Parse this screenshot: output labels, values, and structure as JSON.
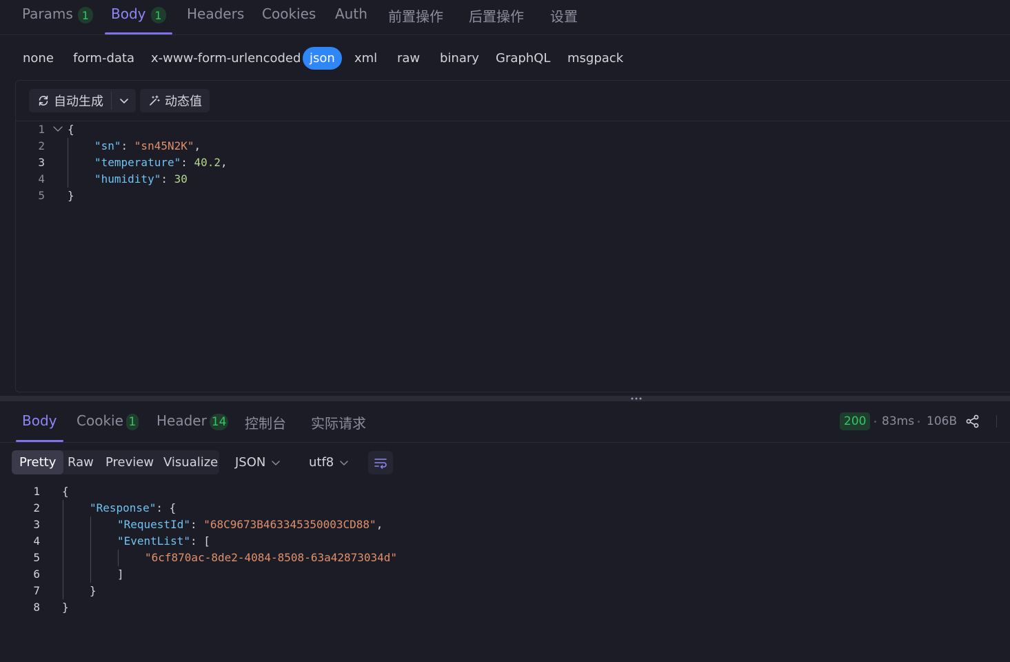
{
  "request_tabs": [
    {
      "label": "Params",
      "badge": "1"
    },
    {
      "label": "Body",
      "badge": "1",
      "active": true
    },
    {
      "label": "Headers"
    },
    {
      "label": "Cookies"
    },
    {
      "label": "Auth"
    },
    {
      "label": "前置操作"
    },
    {
      "label": "后置操作"
    },
    {
      "label": "设置"
    }
  ],
  "body_types": [
    "none",
    "form-data",
    "x-www-form-urlencoded",
    "json",
    "xml",
    "raw",
    "binary",
    "GraphQL",
    "msgpack"
  ],
  "body_type_active": "json",
  "toolbar": {
    "auto_generate": "自动生成",
    "dynamic_value": "动态值"
  },
  "request_body": {
    "line_numbers": [
      "1",
      "2",
      "3",
      "4",
      "5"
    ],
    "open_brace": "{",
    "close_brace": "}",
    "fields": [
      {
        "key": "\"sn\"",
        "sep": ": ",
        "value": "\"sn45N2K\"",
        "value_type": "string",
        "trail": ","
      },
      {
        "key": "\"temperature\"",
        "sep": ": ",
        "value": "40.2",
        "value_type": "number",
        "trail": ","
      },
      {
        "key": "\"humidity\"",
        "sep": ": ",
        "value": "30",
        "value_type": "number",
        "trail": ""
      }
    ]
  },
  "response_tabs": [
    {
      "label": "Body",
      "active": true
    },
    {
      "label": "Cookie",
      "badge": "1"
    },
    {
      "label": "Header",
      "badge": "14"
    },
    {
      "label": "控制台"
    },
    {
      "label": "实际请求"
    }
  ],
  "response_status": {
    "code": "200",
    "time": "83ms",
    "size": "106B"
  },
  "response_view": {
    "modes": [
      "Pretty",
      "Raw",
      "Preview",
      "Visualize"
    ],
    "active_mode": "Pretty",
    "format": "JSON",
    "encoding": "utf8"
  },
  "response_body": {
    "line_numbers": [
      "1",
      "2",
      "3",
      "4",
      "5",
      "6",
      "7",
      "8"
    ],
    "l1": "{",
    "response_key": "\"Response\"",
    "response_sep": ": {",
    "request_id_key": "\"RequestId\"",
    "request_id_sep": ": ",
    "request_id_value": "\"68C9673B463345350003CD88\"",
    "request_id_trail": ",",
    "event_list_key": "\"EventList\"",
    "event_list_sep": ": [",
    "event_value": "\"6cf870ac-8de2-4084-8508-63a42873034d\"",
    "l6": "]",
    "l7": "}",
    "l8": "}"
  },
  "colors": {
    "background": "#1c1c27",
    "accent": "#8f86f5",
    "active_pill": "#2f86f7",
    "success": "#35c467",
    "json_key": "#6fc3f0",
    "json_string": "#e0906a",
    "json_number": "#b5d78b"
  }
}
